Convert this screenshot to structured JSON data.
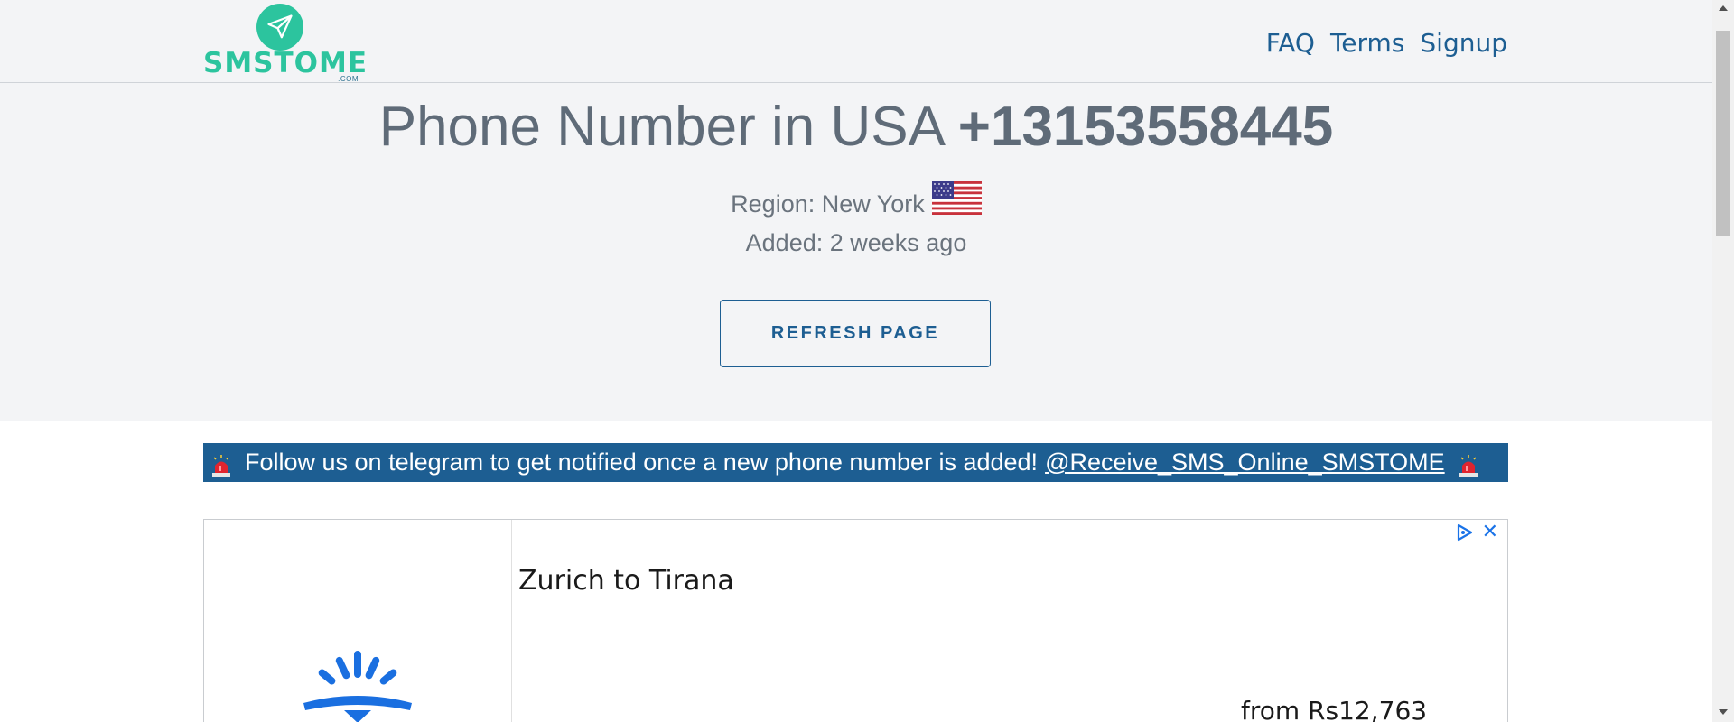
{
  "header": {
    "logo_text": "SMSTOME",
    "logo_sub": ".COM",
    "nav": [
      "FAQ",
      "Terms",
      "Signup"
    ]
  },
  "hero": {
    "title_prefix": "Phone Number in USA",
    "phone_number": "+13153558445",
    "region": "Region: New York",
    "added": "Added: 2 weeks ago",
    "refresh_label": "REFRESH PAGE"
  },
  "banner": {
    "text": "Follow us on telegram to get notified once a new phone number is added!",
    "link": "@Receive_SMS_Online_SMSTOME"
  },
  "ad": {
    "title": "Zurich to Tirana",
    "price": "from Rs12,763",
    "close": "✕"
  },
  "colors": {
    "brand_green": "#2cc49e",
    "brand_blue": "#1d5e92",
    "hero_bg": "#f3f4f6"
  }
}
